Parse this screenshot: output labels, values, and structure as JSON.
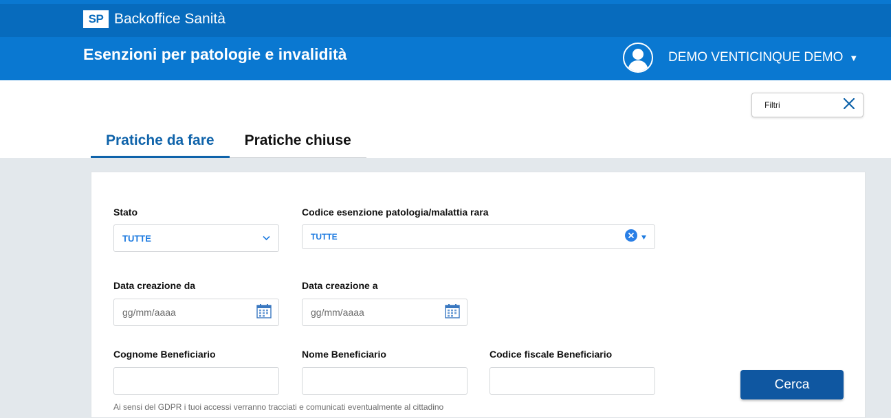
{
  "header": {
    "logo_text": "SP",
    "app_name": "Backoffice Sanità",
    "section_title": "Esenzioni per patologie e invalidità",
    "user_name": "DEMO VENTICINQUE DEMO",
    "user_caret": "▼"
  },
  "filters_box": {
    "label": "Filtri"
  },
  "tabs": [
    {
      "label": "Pratiche da fare",
      "active": true
    },
    {
      "label": "Pratiche chiuse",
      "active": false
    }
  ],
  "form": {
    "stato": {
      "label": "Stato",
      "value": "TUTTE"
    },
    "codice_esenzione": {
      "label": "Codice esenzione patologia/malattia rara",
      "value": "TUTTE"
    },
    "data_da": {
      "label": "Data creazione da",
      "placeholder": "gg/mm/aaaa"
    },
    "data_a": {
      "label": "Data creazione a",
      "placeholder": "gg/mm/aaaa"
    },
    "cognome": {
      "label": "Cognome Beneficiario",
      "value": ""
    },
    "nome": {
      "label": "Nome Beneficiario",
      "value": ""
    },
    "codice_fiscale": {
      "label": "Codice fiscale Beneficiario",
      "value": ""
    },
    "search_button": "Cerca",
    "gdpr_notice": "Ai sensi del GDPR i tuoi accessi verranno tracciati e comunicati eventualmente al cittadino"
  },
  "colors": {
    "header_blue": "#0a78d1",
    "header_top_blue": "#076bbd",
    "accent_blue": "#1e7be0",
    "button_blue": "#0f57a1",
    "content_bg": "#e3e8ec"
  },
  "icons": [
    "user-avatar-icon",
    "close-icon",
    "chevron-down-icon",
    "clear-selection-icon",
    "calendar-icon"
  ]
}
